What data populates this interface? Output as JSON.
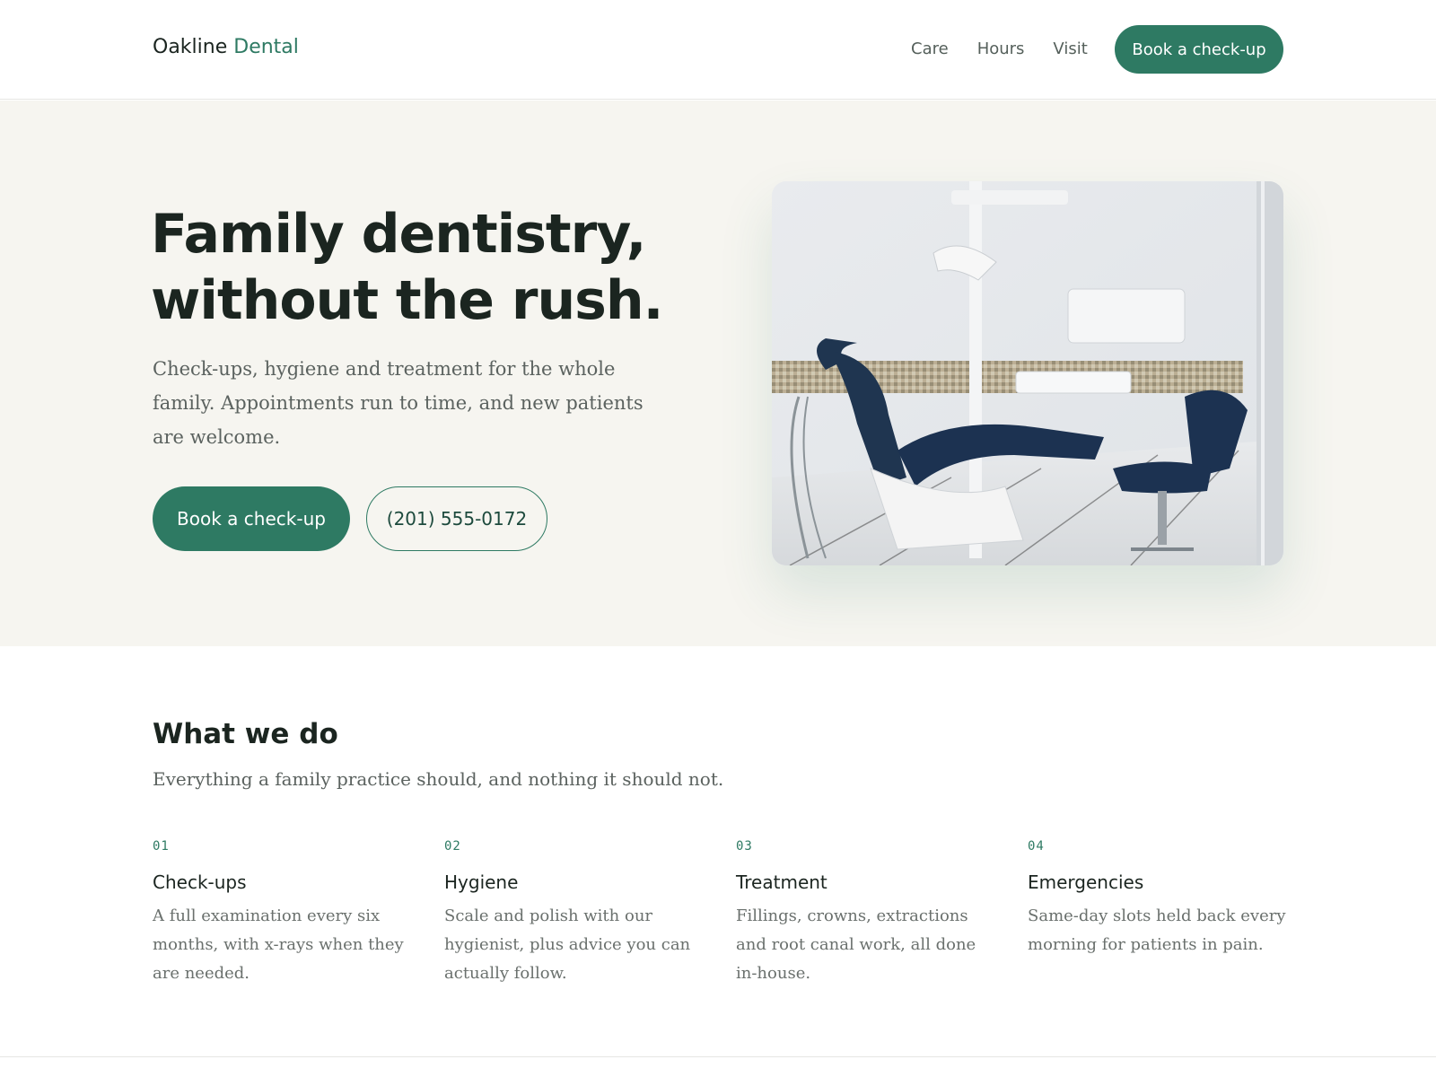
{
  "header": {
    "logo_primary": "Oakline",
    "logo_accent": "Dental",
    "nav": [
      "Care",
      "Hours",
      "Visit"
    ],
    "cta_label": "Book a check-up"
  },
  "hero": {
    "title_line1": "Family dentistry,",
    "title_line2": "without the rush.",
    "subtitle": "Check-ups, hygiene and treatment for the whole family. Appointments run to time, and new patients are welcome.",
    "primary_cta": "Book a check-up",
    "phone": "(201) 555-0172",
    "image_subject": "dental treatment room with patient chair"
  },
  "services": {
    "title": "What we do",
    "subtitle": "Everything a family practice should, and nothing it should not.",
    "items": [
      {
        "num": "01",
        "name": "Check-ups",
        "desc": "A full examination every six months, with x-rays when they are needed."
      },
      {
        "num": "02",
        "name": "Hygiene",
        "desc": "Scale and polish with our hygienist, plus advice you can actually follow."
      },
      {
        "num": "03",
        "name": "Treatment",
        "desc": "Fillings, crowns, extractions and root canal work, all done in-house."
      },
      {
        "num": "04",
        "name": "Emergencies",
        "desc": "Same-day slots held back every morning for patients in pain."
      }
    ]
  },
  "colors": {
    "accent": "#2e7a63",
    "hero_bg": "#f6f5f0",
    "text_dark": "#1b2520",
    "text_muted": "#5b625f"
  }
}
